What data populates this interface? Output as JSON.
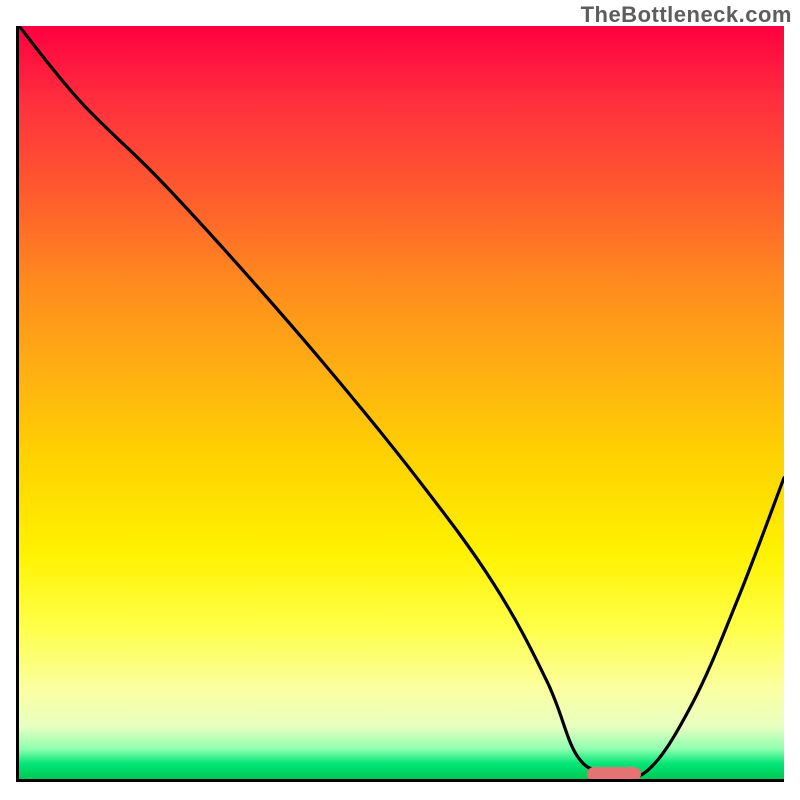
{
  "attribution": "TheBottleneck.com",
  "colors": {
    "gradient_top": "#ff0040",
    "gradient_mid": "#ffd400",
    "gradient_bottom": "#00c853",
    "curve": "#000000",
    "marker": "#e57373",
    "axis": "#000000"
  },
  "chart_data": {
    "type": "line",
    "title": "",
    "xlabel": "",
    "ylabel": "",
    "xlim": [
      0,
      100
    ],
    "ylim": [
      0,
      100
    ],
    "grid": false,
    "legend": false,
    "annotations": [
      {
        "label": "TheBottleneck.com",
        "x": 100,
        "y": 106,
        "anchor": "top-right"
      }
    ],
    "series": [
      {
        "name": "bottleneck-curve",
        "x": [
          0,
          8,
          18,
          28,
          40,
          52,
          62,
          69,
          73,
          77,
          82,
          88,
          94,
          100
        ],
        "y": [
          100,
          90,
          80,
          69,
          55,
          40,
          26,
          13,
          3,
          1,
          1,
          10,
          24,
          40
        ]
      }
    ],
    "marker": {
      "name": "optimal-range",
      "x_start": 74,
      "x_end": 81,
      "y": 1
    },
    "background_gradient": {
      "direction": "vertical",
      "stops": [
        {
          "pos": 0.0,
          "color": "#ff0040"
        },
        {
          "pos": 0.5,
          "color": "#ffd400"
        },
        {
          "pos": 0.8,
          "color": "#ffff4a"
        },
        {
          "pos": 0.96,
          "color": "#8fffb0"
        },
        {
          "pos": 1.0,
          "color": "#00c853"
        }
      ]
    }
  }
}
